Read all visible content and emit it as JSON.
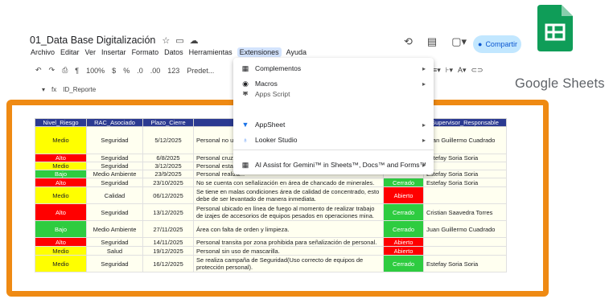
{
  "doc": {
    "title": "01_Data Base Digitalización"
  },
  "menubar": [
    "Archivo",
    "Editar",
    "Ver",
    "Insertar",
    "Formato",
    "Datos",
    "Herramientas",
    "Extensiones",
    "Ayuda"
  ],
  "toolbar": {
    "zoom": "100%",
    "currency": "$",
    "percent": "%",
    "dec_less": ".0",
    "dec_more": ".00",
    "format123": "123",
    "font": "Predet..."
  },
  "formula": {
    "fx": "fx",
    "cell": "ID_Reporte"
  },
  "share": {
    "label": "Compartir"
  },
  "brand": {
    "name": "Google Sheets",
    "color": "#0f9d58"
  },
  "extensions_menu": {
    "items": [
      {
        "label": "Complementos",
        "icon": "addons-icon"
      },
      {
        "label": "Macros",
        "icon": "macros-icon"
      },
      {
        "label": "Apps Script",
        "icon": "apps-script-icon"
      },
      {
        "label": "AppSheet",
        "icon": "appsheet-icon"
      },
      {
        "label": "Looker Studio",
        "icon": "looker-studio-icon"
      },
      {
        "label": "AI Assist for Gemini™ in Sheets™, Docs™ and Forms™",
        "icon": "ai-assist-icon"
      }
    ]
  },
  "table": {
    "headers": [
      "Nivel_Riesgo",
      "RAC_Asociado",
      "Plazo_Cierre",
      "",
      "",
      "Supervisor_Responsable"
    ],
    "rows": [
      {
        "nivel": "Medio",
        "rac": "Seguridad",
        "plazo": "5/12/2025",
        "desc": "Personal no u... lo incumple e... riesgo(trabajo...",
        "estado": "",
        "supervisor": "Juan Guillermo Cuadrado"
      },
      {
        "nivel": "Alto",
        "rac": "Seguridad",
        "plazo": "6/8/2025",
        "desc": "Personal cruz...",
        "estado": "",
        "supervisor": "Estefay Soria Soria"
      },
      {
        "nivel": "Medio",
        "rac": "Seguridad",
        "plazo": "3/12/2025",
        "desc": "Personal esta...",
        "estado": "",
        "supervisor": ""
      },
      {
        "nivel": "Bajo",
        "rac": "Medio Ambiente",
        "plazo": "23/9/2025",
        "desc": "Personal realiza...",
        "estado": "",
        "supervisor": "Estefay Soria Soria"
      },
      {
        "nivel": "Alto",
        "rac": "Seguridad",
        "plazo": "23/10/2025",
        "desc": "No se cuenta con señalización en área de chancado de minerales.",
        "estado": "Cerrado",
        "supervisor": "Estefay Soria Soria"
      },
      {
        "nivel": "Medio",
        "rac": "Calidad",
        "plazo": "06/12/2025",
        "desc": "Se tiene en malas condiciones área de calidad de concentrado, esto debe de ser levantado de manera inmediata.",
        "estado": "Abierto",
        "supervisor": ""
      },
      {
        "nivel": "Alto",
        "rac": "Seguridad",
        "plazo": "13/12/2025",
        "desc": "Personal ubicado en línea de fuego al momento de realizar trabajo de izajes de accesorios de equipos pesados en operaciones mina.",
        "estado": "Cerrado",
        "supervisor": "Cristian Saavedra Torres"
      },
      {
        "nivel": "Bajo",
        "rac": "Medio Ambiente",
        "plazo": "27/11/2025",
        "desc": "Área con falta de orden y limpieza.",
        "estado": "Cerrado",
        "supervisor": "Juan Guillermo Cuadrado"
      },
      {
        "nivel": "Alto",
        "rac": "Seguridad",
        "plazo": "14/11/2025",
        "desc": "Personal transita por zona prohibida para señalización de personal.",
        "estado": "Abierto",
        "supervisor": ""
      },
      {
        "nivel": "Medio",
        "rac": "Salud",
        "plazo": "19/12/2025",
        "desc": "Personal sin uso de mascarilla.",
        "estado": "Abierto",
        "supervisor": ""
      },
      {
        "nivel": "Medio",
        "rac": "Seguridad",
        "plazo": "16/12/2025",
        "desc": "Se realiza campaña de Seguridad(Uso correcto de equipos de protección personal).",
        "estado": "Cerrado",
        "supervisor": "Estefay Soria Soria"
      }
    ]
  }
}
